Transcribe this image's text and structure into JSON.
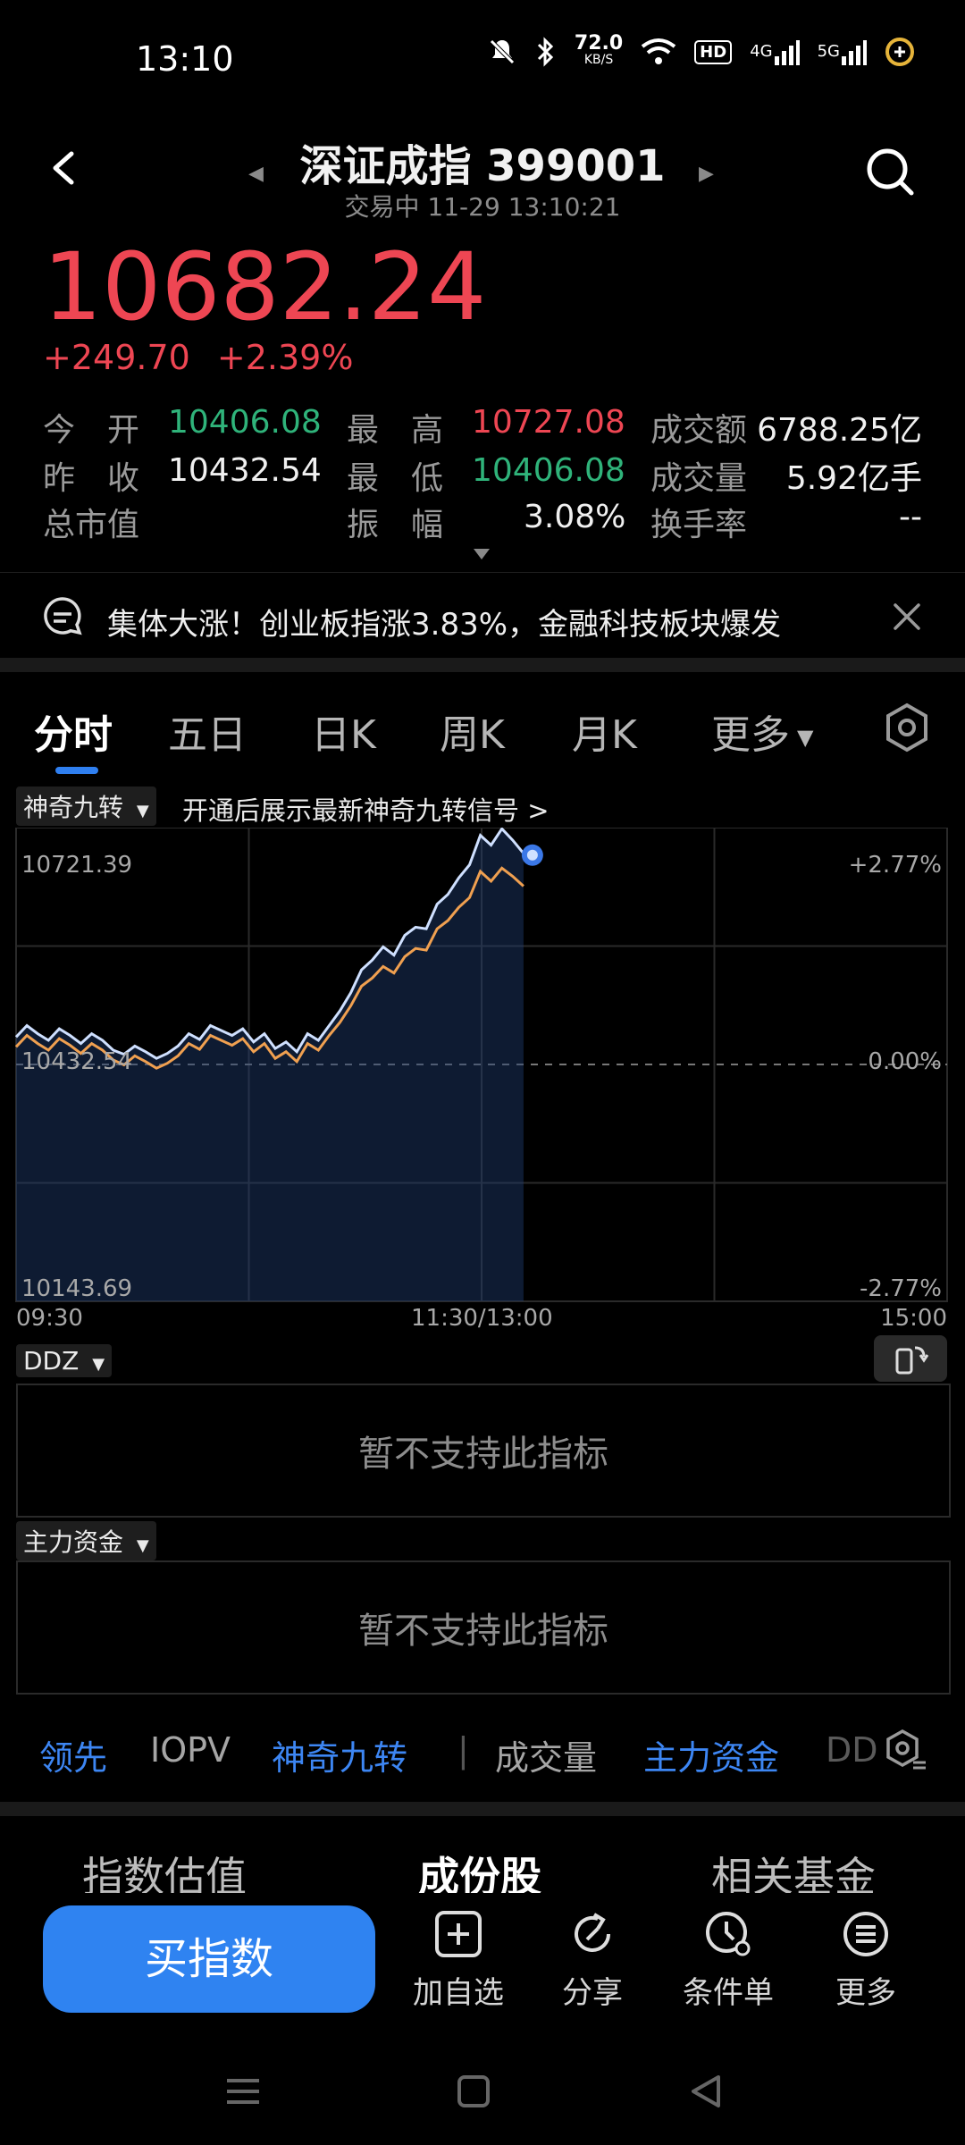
{
  "status_bar": {
    "time": "13:10",
    "net_speed_value": "72.0",
    "net_speed_unit": "KB/S",
    "hd_badge": "HD",
    "sig1": "4G",
    "sig2": "5G",
    "icons": [
      "mute-icon",
      "bluetooth-icon",
      "wifi-icon",
      "battery-icon"
    ]
  },
  "header": {
    "title": "深证成指 399001",
    "subtitle": "交易中 11-29 13:10:21"
  },
  "quote": {
    "price": "10682.24",
    "change": "+249.70",
    "change_pct": "+2.39%"
  },
  "stats": {
    "open_label": "今　开",
    "open": "10406.08",
    "high_label": "最　高",
    "high": "10727.08",
    "amount_label": "成交额",
    "amount": "6788.25亿",
    "prev_close_label": "昨　收",
    "prev_close": "10432.54",
    "low_label": "最　低",
    "low": "10406.08",
    "volume_label": "成交量",
    "volume": "5.92亿手",
    "mcap_label": "总市值",
    "mcap": "",
    "amplitude_label": "振　幅",
    "amplitude": "3.08%",
    "turnover_label": "换手率",
    "turnover": "--"
  },
  "news": {
    "text": "集体大涨！创业板指涨3.83%，金融科技板块爆发"
  },
  "tabs": [
    "分时",
    "五日",
    "日K",
    "周K",
    "月K",
    "更多"
  ],
  "chart_toolbar": {
    "chip": "神奇九转",
    "hint": "开通后展示最新神奇九转信号 >"
  },
  "chart_data": {
    "type": "line",
    "y_top_label": "10721.39",
    "y_mid_label": "10432.54",
    "y_bottom_label": "10143.69",
    "pct_top": "+2.77%",
    "pct_mid": "0.00%",
    "pct_bottom": "-2.77%",
    "x_labels": [
      "09:30",
      "11:30/13:00",
      "15:00"
    ],
    "ylim": [
      10143.69,
      10721.39
    ],
    "series": [
      {
        "values": [
          10466,
          10480,
          10470,
          10462,
          10476,
          10468,
          10458,
          10470,
          10462,
          10450,
          10445,
          10455,
          10448,
          10440,
          10446,
          10455,
          10470,
          10463,
          10480,
          10474,
          10468,
          10476,
          10460,
          10470,
          10452,
          10460,
          10448,
          10470,
          10462,
          10480,
          10498,
          10520,
          10548,
          10560,
          10576,
          10566,
          10590,
          10600,
          10598,
          10628,
          10640,
          10660,
          10676,
          10712,
          10700,
          10720,
          10706,
          10690
        ]
      },
      {
        "values": [
          10454,
          10468,
          10458,
          10450,
          10464,
          10456,
          10446,
          10458,
          10450,
          10438,
          10432,
          10443,
          10436,
          10428,
          10434,
          10443,
          10458,
          10451,
          10468,
          10462,
          10456,
          10464,
          10448,
          10458,
          10440,
          10448,
          10436,
          10458,
          10450,
          10468,
          10484,
          10504,
          10528,
          10538,
          10552,
          10544,
          10564,
          10574,
          10572,
          10598,
          10608,
          10624,
          10636,
          10668,
          10656,
          10672,
          10662,
          10650
        ]
      }
    ]
  },
  "indicators": {
    "ddz_chip": "DDZ",
    "ddz_msg": "暂不支持此指标",
    "main_chip": "主力资金",
    "main_msg": "暂不支持此指标"
  },
  "indicator_tabs": [
    "领先",
    "IOPV",
    "神奇九转",
    "成交量",
    "主力资金",
    "DD"
  ],
  "section_tabs": [
    "指数估值",
    "成份股",
    "相关基金"
  ],
  "bottom_bar": {
    "buy": "买指数",
    "add": "加自选",
    "share": "分享",
    "condition": "条件单",
    "more": "更多"
  }
}
